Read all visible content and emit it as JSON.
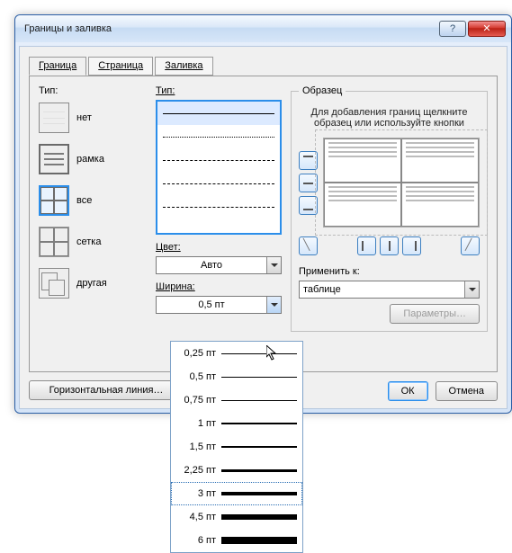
{
  "window": {
    "title": "Границы и заливка",
    "help": "?",
    "close": "✕"
  },
  "tabs": {
    "border": "Граница",
    "page": "Страница",
    "fill": "Заливка"
  },
  "left": {
    "label": "Тип:",
    "none": "нет",
    "box": "рамка",
    "all": "все",
    "grid": "сетка",
    "custom": "другая"
  },
  "style": {
    "type_label": "Тип:",
    "color_label": "Цвет:",
    "color_value": "Авто",
    "width_label": "Ширина:",
    "width_value": "0,5 пт"
  },
  "width_options": [
    "0,25 пт",
    "0,5 пт",
    "0,75 пт",
    "1 пт",
    "1,5 пт",
    "2,25 пт",
    "3 пт",
    "4,5 пт",
    "6 пт"
  ],
  "preview": {
    "legend": "Образец",
    "hint": "Для добавления границ щелкните образец или используйте кнопки"
  },
  "apply": {
    "label": "Применить к:",
    "value": "таблице",
    "options_btn": "Параметры…"
  },
  "hlink": "Горизонтальная линия…",
  "ok": "ОК",
  "cancel": "Отмена"
}
